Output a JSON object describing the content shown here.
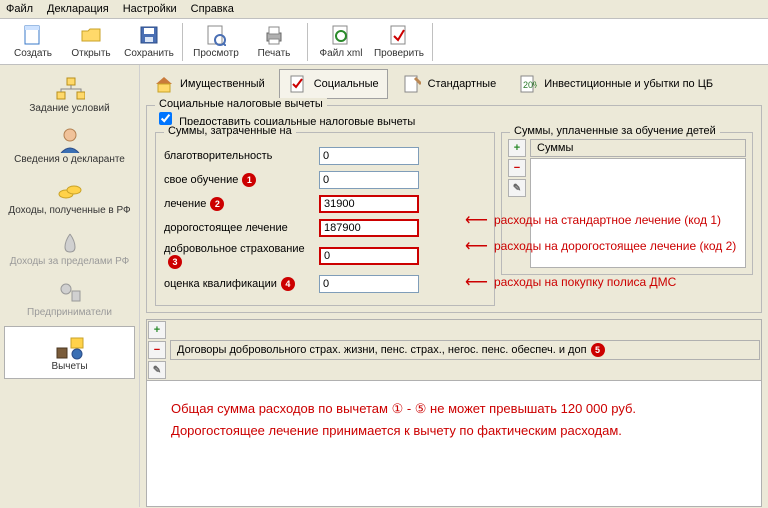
{
  "menu": {
    "items": [
      "Файл",
      "Декларация",
      "Настройки",
      "Справка"
    ]
  },
  "toolbar": {
    "create": "Создать",
    "open": "Открыть",
    "save": "Сохранить",
    "preview": "Просмотр",
    "print": "Печать",
    "filexml": "Файл xml",
    "check": "Проверить"
  },
  "sidebar": {
    "items": [
      {
        "label": "Задание условий"
      },
      {
        "label": "Сведения о декларанте"
      },
      {
        "label": "Доходы, полученные в РФ"
      },
      {
        "label": "Доходы за пределами РФ"
      },
      {
        "label": "Предприниматели"
      },
      {
        "label": "Вычеты"
      }
    ]
  },
  "tabs": {
    "property": "Имущественный",
    "social": "Социальные",
    "standard": "Стандартные",
    "invest": "Инвестиционные и убытки по ЦБ"
  },
  "social": {
    "group_title": "Социальные налоговые вычеты",
    "checkbox": "Предоставить социальные налоговые вычеты",
    "subgroup": "Суммы, затраченные на",
    "lines": {
      "charity": {
        "label": "благотворительность",
        "value": "0"
      },
      "own_edu": {
        "label": "свое обучение",
        "value": "0",
        "badge": "1"
      },
      "treat": {
        "label": "лечение",
        "value": "31900",
        "badge": "2"
      },
      "exp_treat": {
        "label": "дорогостоящее лечение",
        "value": "187900"
      },
      "ins": {
        "label": "добровольное страхование",
        "value": "0",
        "badge": "3"
      },
      "qual": {
        "label": "оценка квалификации",
        "value": "0",
        "badge": "4"
      }
    },
    "child_edu": {
      "title": "Суммы, уплаченные за обучение детей",
      "col": "Суммы"
    },
    "annotations": {
      "a1": "расходы на стандартное лечение (код 1)",
      "a2": "расходы на дорогостоящее лечение (код 2)",
      "a3": "расходы на покупку полиса ДМС"
    }
  },
  "bottom": {
    "title": "Договоры добровольного страх. жизни, пенс. страх., негос. пенс. обеспеч. и доп",
    "badge": "5",
    "line1": "Общая сумма расходов по вычетам ① - ⑤ не может превышать 120 000 руб.",
    "line2": "Дорогостоящее лечение принимается к вычету по фактическим расходам."
  }
}
